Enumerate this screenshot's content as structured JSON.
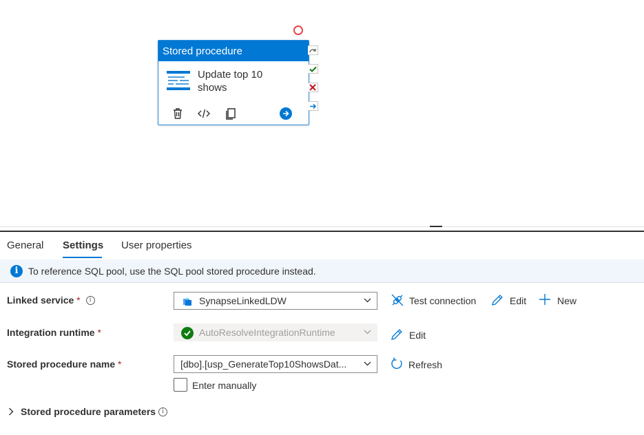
{
  "activity": {
    "type_label": "Stored procedure",
    "name": "Update top 10 shows",
    "tools": [
      "delete-icon",
      "code-icon",
      "copy-icon",
      "arrow-circle-icon"
    ],
    "accent": "#0078d4"
  },
  "tabs": [
    {
      "label": "General",
      "active": false
    },
    {
      "label": "Settings",
      "active": true
    },
    {
      "label": "User properties",
      "active": false
    }
  ],
  "info_bar": {
    "icon": "info-icon",
    "text": "To reference SQL pool, use the SQL pool stored procedure instead."
  },
  "form": {
    "linked_service": {
      "label": "Linked service",
      "required_mark": "*",
      "info_glyph": "i",
      "value": "SynapseLinkedLDW",
      "test_connection": "Test connection",
      "edit": "Edit",
      "new": "New"
    },
    "integration_runtime": {
      "label": "Integration runtime",
      "required_mark": "*",
      "value": "AutoResolveIntegrationRuntime",
      "edit": "Edit"
    },
    "stored_procedure_name": {
      "label": "Stored procedure name",
      "required_mark": "*",
      "value": "[dbo].[usp_GenerateTop10ShowsDat...",
      "refresh": "Refresh",
      "enter_manually": "Enter manually",
      "enter_manually_checked": false
    },
    "parameters": {
      "label": "Stored procedure parameters",
      "info_glyph": "i"
    }
  },
  "colors": {
    "primary": "#0078d4",
    "error": "#e8474a",
    "success": "#107c10",
    "required": "#a4262c"
  }
}
